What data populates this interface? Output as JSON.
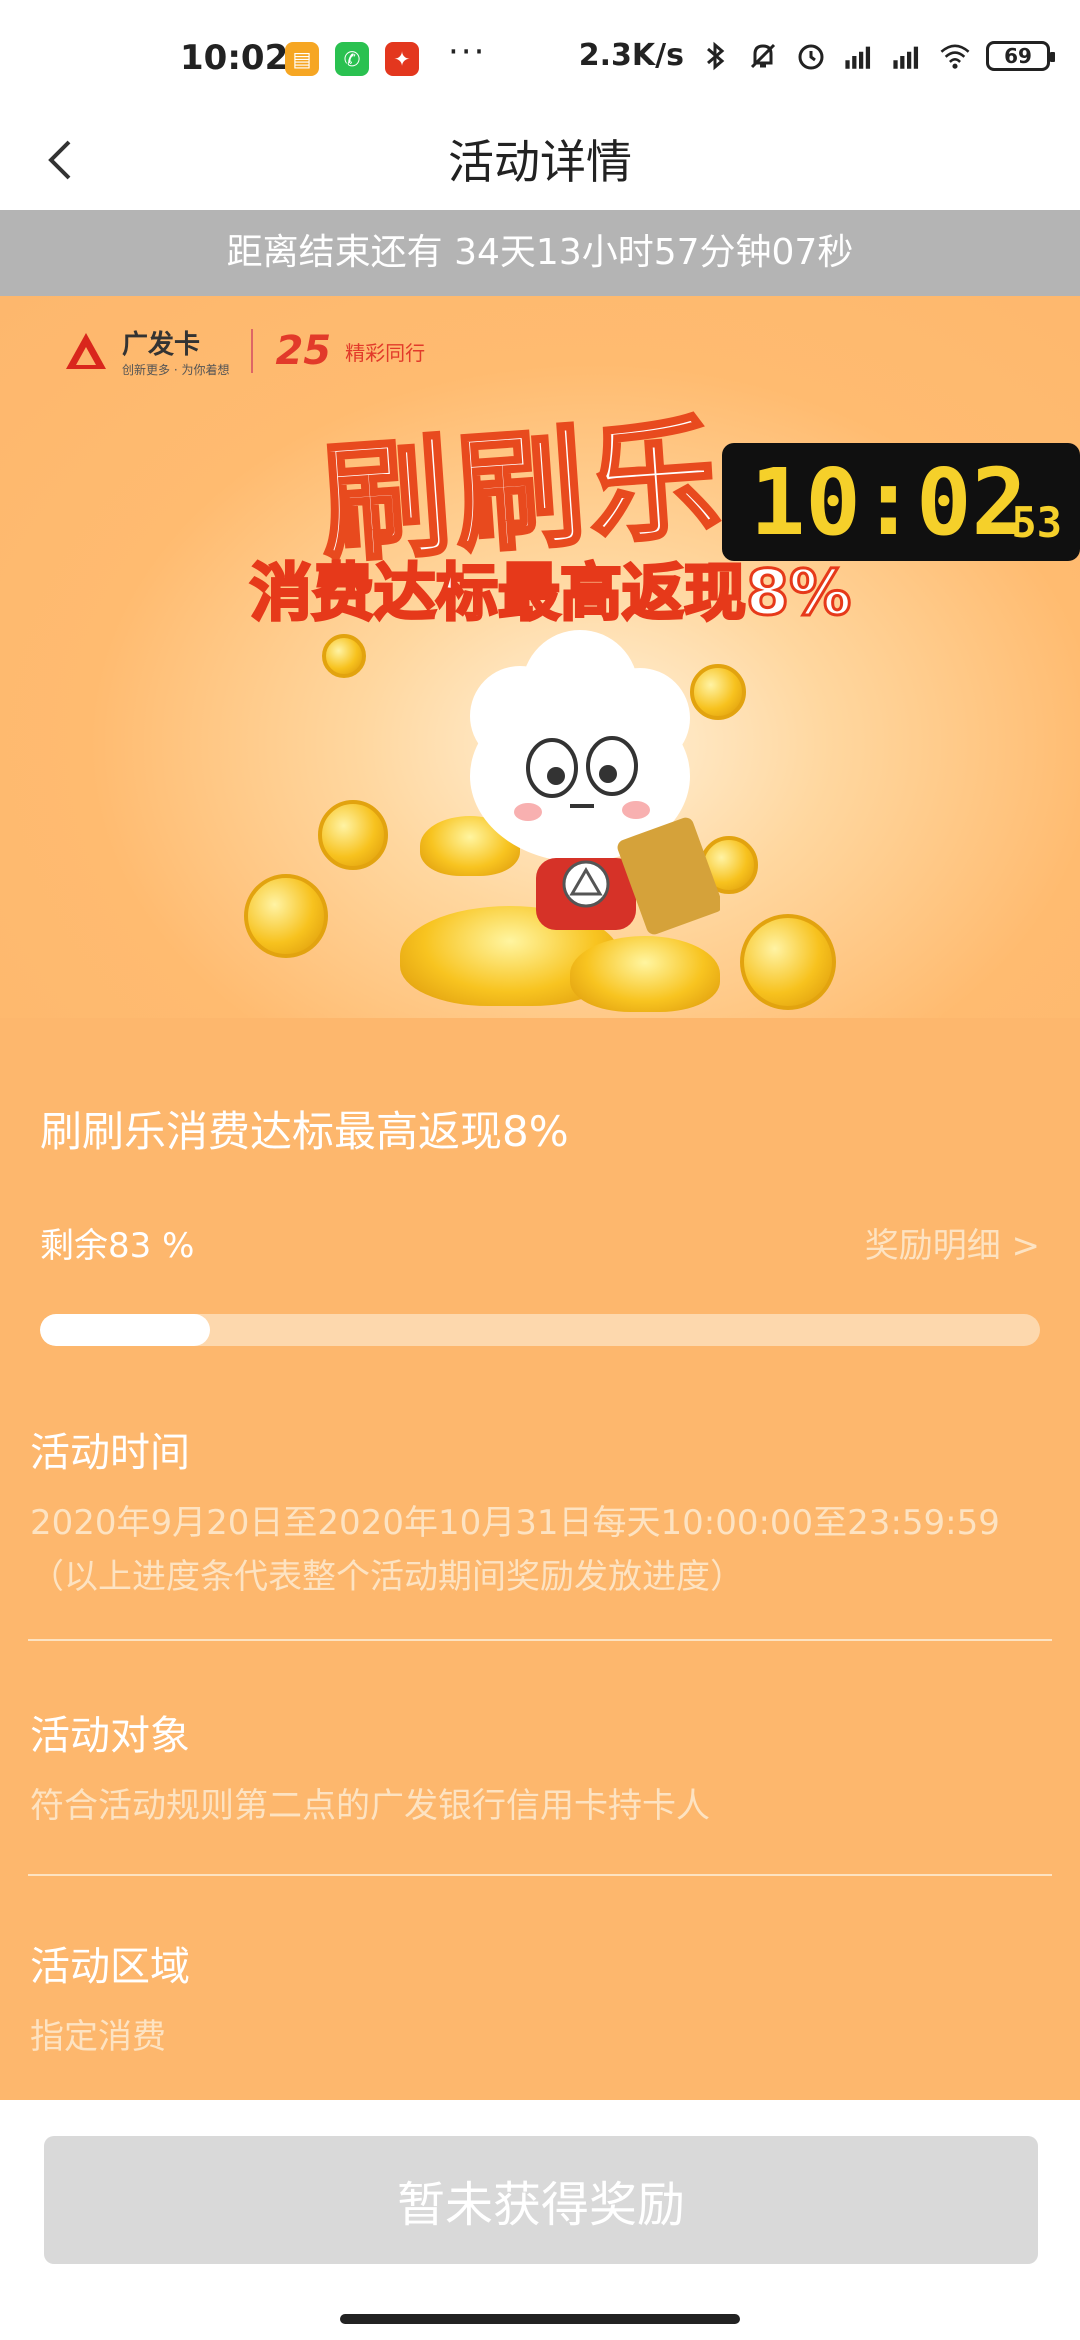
{
  "status_bar": {
    "time": "10:02",
    "dots": "···",
    "net_speed": "2.3K/s",
    "battery": "69",
    "icons": [
      "folder-app-icon",
      "wechat-icon",
      "red-app-icon",
      "bluetooth-icon",
      "mute-icon",
      "alarm-icon",
      "hd-signal-icon",
      "hd-signal-icon",
      "wifi-icon",
      "battery-icon"
    ]
  },
  "header": {
    "title": "活动详情",
    "back_icon": "chevron-left-icon"
  },
  "countdown": {
    "text": "距离结束还有 34天13小时57分钟07秒"
  },
  "banner": {
    "logo_name": "广发卡",
    "logo_sub": "创新更多 · 为你着想",
    "logo_25": "25",
    "logo_slogan": "精彩同行",
    "title": "刷刷乐",
    "subtitle": "消费达标最高返现8%"
  },
  "clock_overlay": {
    "time": "10:02",
    "seconds": "53"
  },
  "activity": {
    "title": "刷刷乐消费达标最高返现8%",
    "remaining_label": "剩余83 %",
    "reward_link": "奖励明细 >",
    "progress_remaining_percent": 83,
    "progress_fill_fraction": 0.17
  },
  "sections": [
    {
      "label": "活动时间",
      "text": "2020年9月20日至2020年10月31日每天10:00:00至23:59:59 （以上进度条代表整个活动期间奖励发放进度）"
    },
    {
      "label": "活动对象",
      "text": "符合活动规则第二点的广发银行信用卡持卡人"
    },
    {
      "label": "活动区域",
      "text": "指定消费"
    }
  ],
  "bottom": {
    "button_label": "暂未获得奖励"
  },
  "colors": {
    "page_bg": "#fdb76d",
    "countdown_bg": "#b4b4b4",
    "button_disabled": "#d9d9d9",
    "accent_red": "#e84a1e"
  }
}
